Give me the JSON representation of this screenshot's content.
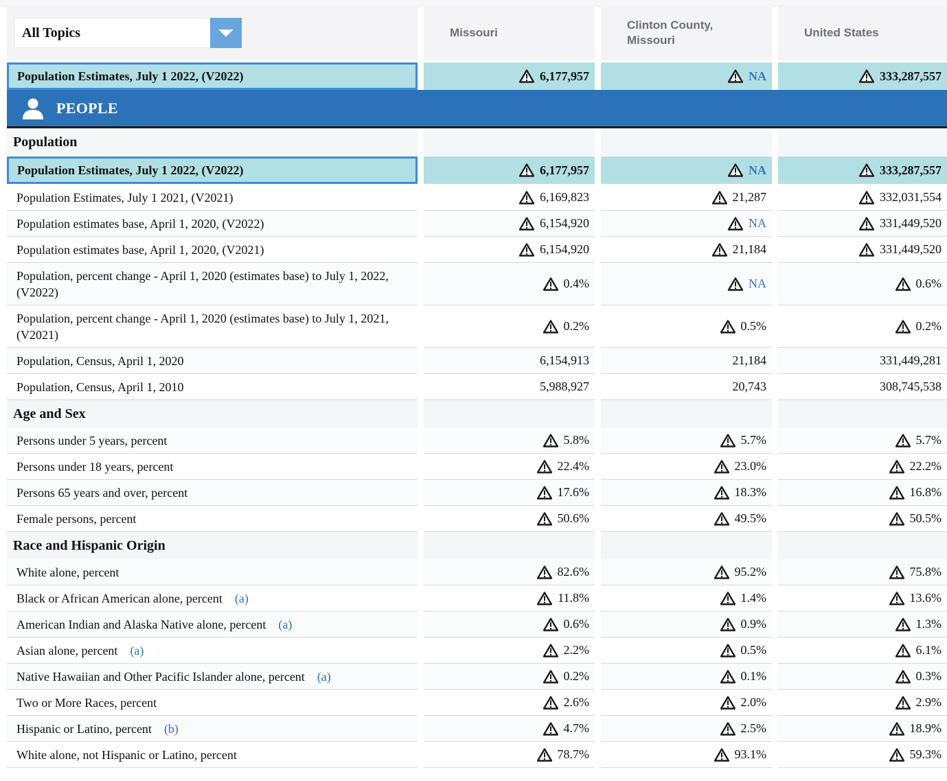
{
  "header": {
    "topic_select": "All Topics",
    "columns": [
      "Missouri",
      "Clinton County, Missouri",
      "United States"
    ]
  },
  "pinned_row": {
    "label": "Population Estimates, July 1 2022, (V2022)",
    "values": [
      "6,177,957",
      "NA",
      "333,287,557"
    ]
  },
  "people_section": {
    "title": "PEOPLE"
  },
  "sections": [
    {
      "title": "Population",
      "rows": [
        {
          "label": "Population Estimates, July 1 2022, (V2022)",
          "note": "",
          "values": [
            "6,177,957",
            "NA",
            "333,287,557"
          ],
          "warn": true,
          "highlight": true,
          "tall": false
        },
        {
          "label": "Population Estimates, July 1 2021, (V2021)",
          "note": "",
          "values": [
            "6,169,823",
            "21,287",
            "332,031,554"
          ],
          "warn": true,
          "highlight": false,
          "tall": false
        },
        {
          "label": "Population estimates base, April 1, 2020, (V2022)",
          "note": "",
          "values": [
            "6,154,920",
            "NA",
            "331,449,520"
          ],
          "warn": true,
          "highlight": false,
          "tall": false
        },
        {
          "label": "Population estimates base, April 1, 2020, (V2021)",
          "note": "",
          "values": [
            "6,154,920",
            "21,184",
            "331,449,520"
          ],
          "warn": true,
          "highlight": false,
          "tall": false
        },
        {
          "label": "Population, percent change - April 1, 2020 (estimates base) to July 1, 2022, (V2022)",
          "note": "",
          "values": [
            "0.4%",
            "NA",
            "0.6%"
          ],
          "warn": true,
          "highlight": false,
          "tall": true
        },
        {
          "label": "Population, percent change - April 1, 2020 (estimates base) to July 1, 2021, (V2021)",
          "note": "",
          "values": [
            "0.2%",
            "0.5%",
            "0.2%"
          ],
          "warn": true,
          "highlight": false,
          "tall": true
        },
        {
          "label": "Population, Census, April 1, 2020",
          "note": "",
          "values": [
            "6,154,913",
            "21,184",
            "331,449,281"
          ],
          "warn": false,
          "highlight": false,
          "tall": false
        },
        {
          "label": "Population, Census, April 1, 2010",
          "note": "",
          "values": [
            "5,988,927",
            "20,743",
            "308,745,538"
          ],
          "warn": false,
          "highlight": false,
          "tall": false
        }
      ]
    },
    {
      "title": "Age and Sex",
      "rows": [
        {
          "label": "Persons under 5 years, percent",
          "note": "",
          "values": [
            "5.8%",
            "5.7%",
            "5.7%"
          ],
          "warn": true,
          "highlight": false,
          "tall": false
        },
        {
          "label": "Persons under 18 years, percent",
          "note": "",
          "values": [
            "22.4%",
            "23.0%",
            "22.2%"
          ],
          "warn": true,
          "highlight": false,
          "tall": false
        },
        {
          "label": "Persons 65 years and over, percent",
          "note": "",
          "values": [
            "17.6%",
            "18.3%",
            "16.8%"
          ],
          "warn": true,
          "highlight": false,
          "tall": false
        },
        {
          "label": "Female persons, percent",
          "note": "",
          "values": [
            "50.6%",
            "49.5%",
            "50.5%"
          ],
          "warn": true,
          "highlight": false,
          "tall": false
        }
      ]
    },
    {
      "title": "Race and Hispanic Origin",
      "rows": [
        {
          "label": "White alone, percent",
          "note": "",
          "values": [
            "82.6%",
            "95.2%",
            "75.8%"
          ],
          "warn": true,
          "highlight": false,
          "tall": false
        },
        {
          "label": "Black or African American alone, percent",
          "note": "(a)",
          "values": [
            "11.8%",
            "1.4%",
            "13.6%"
          ],
          "warn": true,
          "highlight": false,
          "tall": false
        },
        {
          "label": "American Indian and Alaska Native alone, percent",
          "note": "(a)",
          "values": [
            "0.6%",
            "0.9%",
            "1.3%"
          ],
          "warn": true,
          "highlight": false,
          "tall": false
        },
        {
          "label": "Asian alone, percent",
          "note": "(a)",
          "values": [
            "2.2%",
            "0.5%",
            "6.1%"
          ],
          "warn": true,
          "highlight": false,
          "tall": false
        },
        {
          "label": "Native Hawaiian and Other Pacific Islander alone, percent",
          "note": "(a)",
          "values": [
            "0.2%",
            "0.1%",
            "0.3%"
          ],
          "warn": true,
          "highlight": false,
          "tall": false
        },
        {
          "label": "Two or More Races, percent",
          "note": "",
          "values": [
            "2.6%",
            "2.0%",
            "2.9%"
          ],
          "warn": true,
          "highlight": false,
          "tall": false
        },
        {
          "label": "Hispanic or Latino, percent",
          "note": "(b)",
          "values": [
            "4.7%",
            "2.5%",
            "18.9%"
          ],
          "warn": true,
          "highlight": false,
          "tall": false
        },
        {
          "label": "White alone, not Hispanic or Latino, percent",
          "note": "",
          "values": [
            "78.7%",
            "93.1%",
            "59.3%"
          ],
          "warn": true,
          "highlight": false,
          "tall": false
        }
      ]
    }
  ],
  "icons": {
    "warning": "warning-triangle-icon",
    "person": "person-icon",
    "dropdown": "chevron-down-icon"
  },
  "colors": {
    "accent": "#2c72b9",
    "highlight_bg": "#b1dfe4",
    "highlight_border": "#3a8dde",
    "link": "#3a78bd"
  }
}
